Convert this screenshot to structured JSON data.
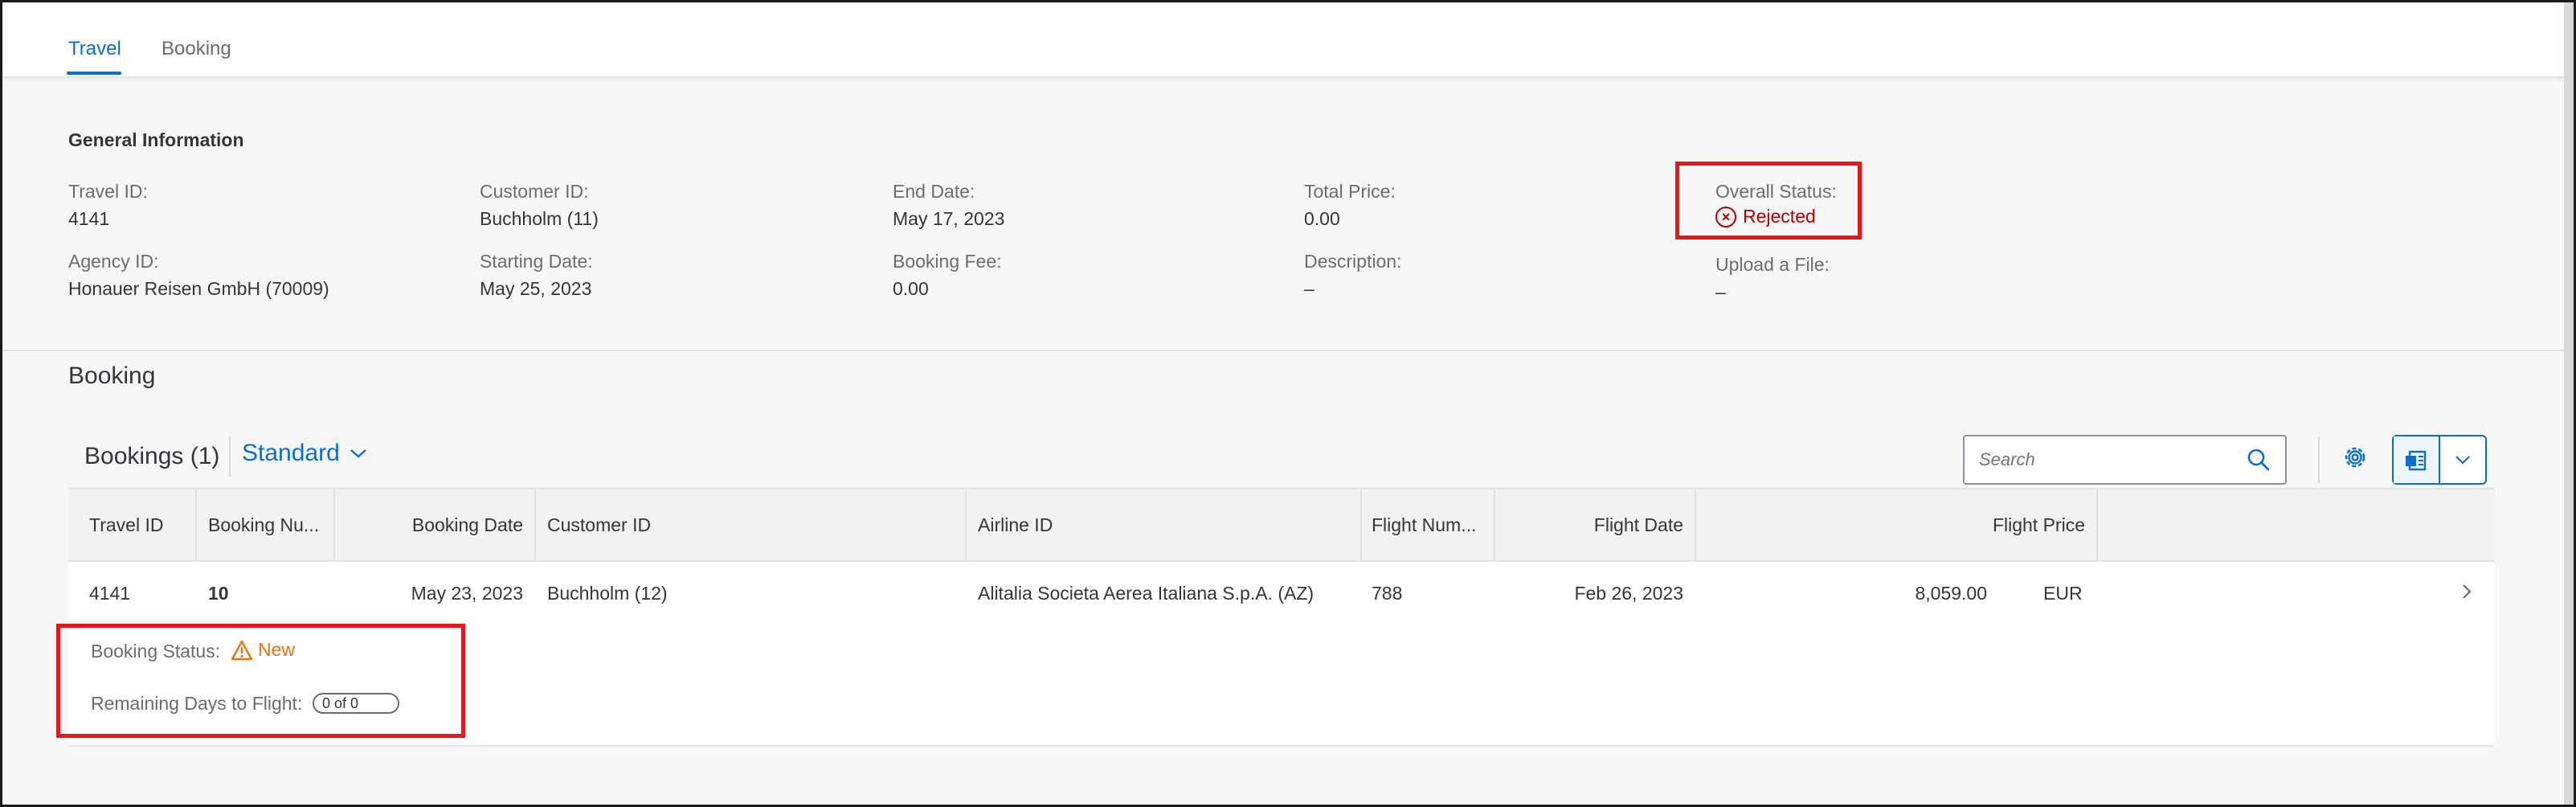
{
  "tabs": [
    {
      "label": "Travel",
      "active": true
    },
    {
      "label": "Booking",
      "active": false
    }
  ],
  "general": {
    "title": "General Information",
    "travel_id_label": "Travel ID:",
    "travel_id": "4141",
    "agency_id_label": "Agency ID:",
    "agency_id": "Honauer Reisen GmbH (70009)",
    "customer_id_label": "Customer ID:",
    "customer_id": "Buchholm (11)",
    "starting_date_label": "Starting Date:",
    "starting_date": "May 25, 2023",
    "end_date_label": "End Date:",
    "end_date": "May 17, 2023",
    "booking_fee_label": "Booking Fee:",
    "booking_fee": "0.00",
    "total_price_label": "Total Price:",
    "total_price": "0.00",
    "description_label": "Description:",
    "description": "–",
    "overall_status_label": "Overall Status:",
    "overall_status": "Rejected",
    "upload_label": "Upload a File:",
    "upload_value": "–"
  },
  "booking_section": {
    "heading": "Booking",
    "table_title": "Bookings (1)",
    "variant": "Standard",
    "search_placeholder": "Search",
    "columns": [
      "Travel ID",
      "Booking Nu...",
      "Booking Date",
      "Customer ID",
      "Airline ID",
      "Flight Num...",
      "Flight Date",
      "Flight Price"
    ],
    "rows": [
      {
        "travel_id": "4141",
        "booking_number": "10",
        "booking_date": "May 23, 2023",
        "customer_id": "Buchholm (12)",
        "airline_id": "Alitalia Societa Aerea Italiana S.p.A. (AZ)",
        "flight_number": "788",
        "flight_date": "Feb 26, 2023",
        "flight_price": "8,059.00",
        "currency": "EUR",
        "booking_status_label": "Booking Status:",
        "booking_status": "New",
        "remaining_days_label": "Remaining Days to Flight:",
        "remaining_days": "0 of 0"
      }
    ]
  },
  "colors": {
    "accent": "#0a6ed1",
    "error": "#bb0000",
    "warning": "#e9730c",
    "highlight_box": "#e8151b"
  }
}
